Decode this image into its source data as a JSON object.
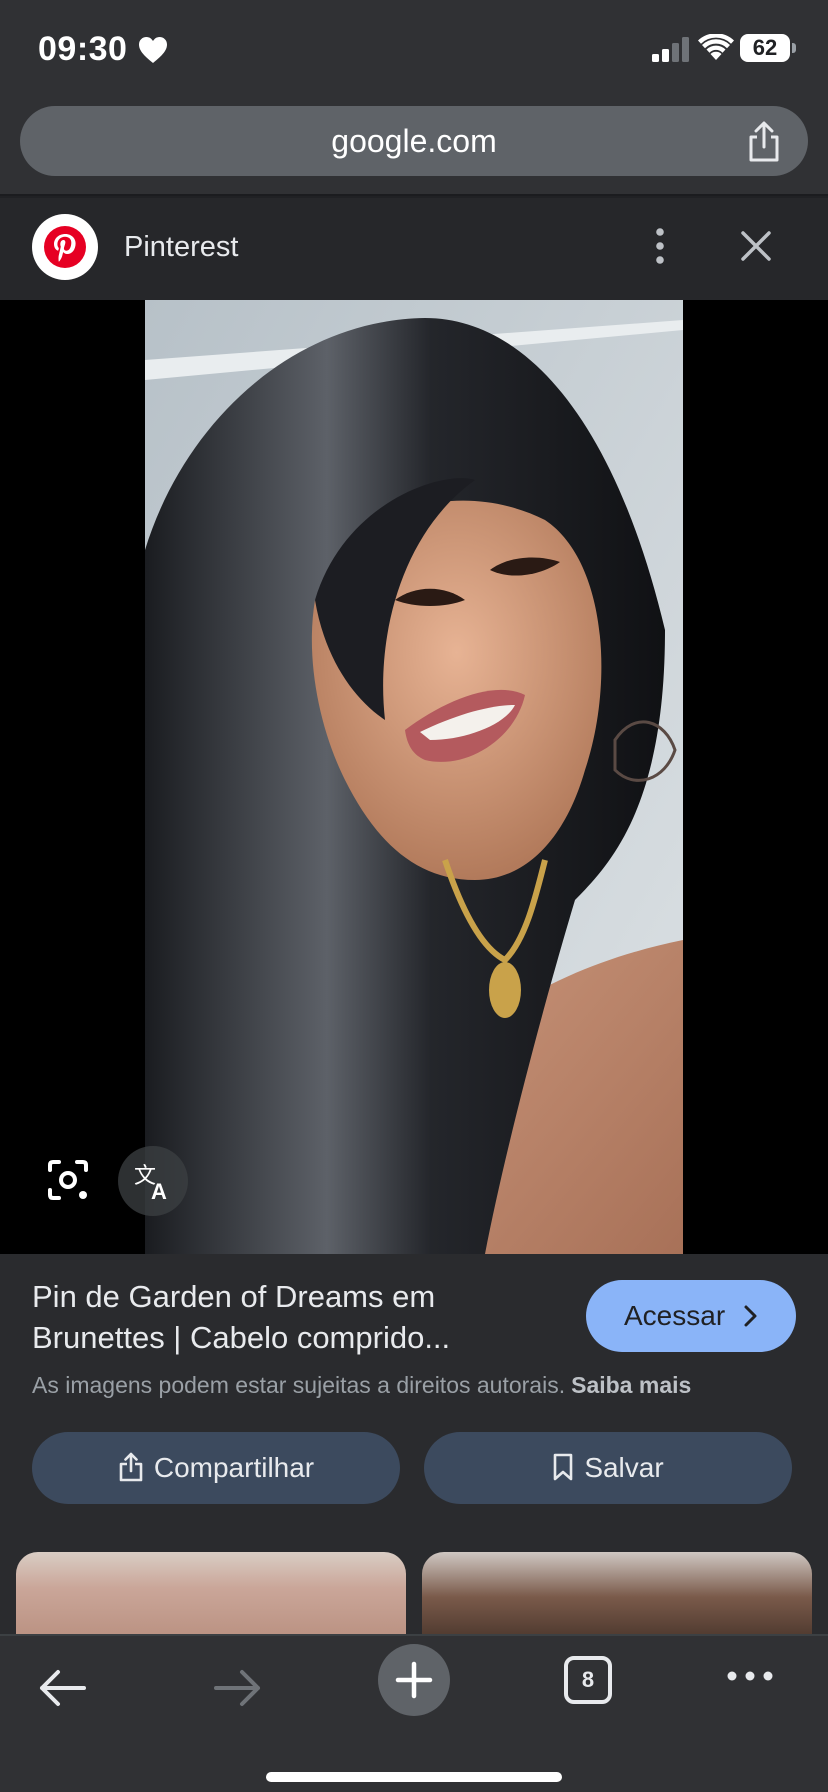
{
  "status_bar": {
    "time": "09:30",
    "battery": "62",
    "icons": [
      "heart-icon",
      "signal-icon",
      "wifi-icon",
      "battery-icon"
    ]
  },
  "browser": {
    "url": "google.com",
    "tab_count": "8"
  },
  "source": {
    "name": "Pinterest",
    "logo": "pinterest-logo",
    "brand_color": "#e60023"
  },
  "viewer": {
    "tools": [
      "lens-icon",
      "translate-icon"
    ]
  },
  "result": {
    "title_line1": "Pin de Garden of Dreams em",
    "title_line2": "Brunettes | Cabelo comprido...",
    "visit_label": "Acessar",
    "copyright_text": "As imagens podem estar sujeitas a direitos autorais.",
    "learn_more": "Saiba mais",
    "share_label": "Compartilhar",
    "save_label": "Salvar"
  },
  "colors": {
    "accent": "#8ab4f8",
    "action_bg": "#3c4a5e",
    "toolbar_bg": "#303134"
  }
}
